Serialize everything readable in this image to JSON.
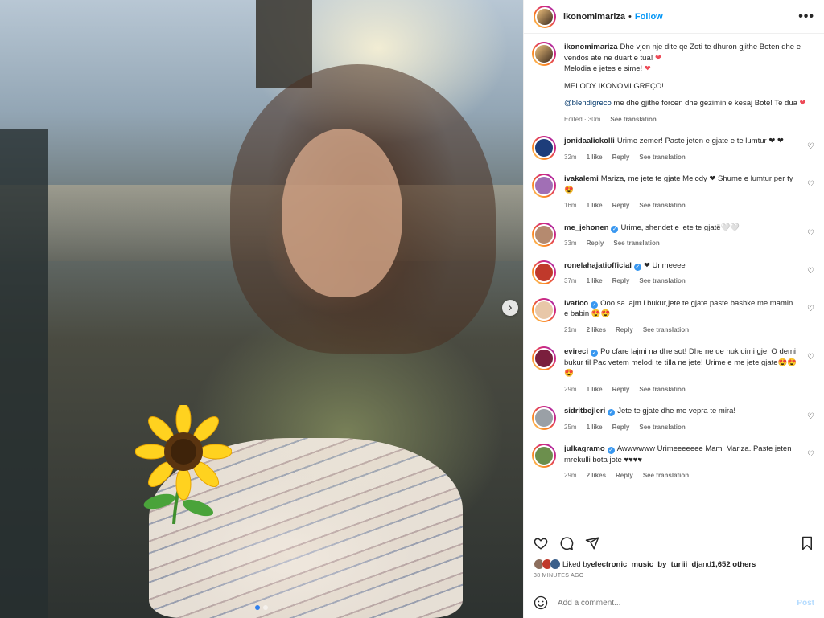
{
  "post": {
    "username": "ikonomimariza",
    "separator": "•",
    "follow_label": "Follow",
    "more_label": "•••",
    "next_label": "›",
    "slide_count": 2,
    "active_slide": 1
  },
  "caption": {
    "username": "ikonomimariza",
    "lines": [
      "Dhe vjen nje dite qe Zoti te dhuron gjithe Boten dhe e vendos ate ne duart e tua! ",
      "Melodia e jetes e sime! ",
      "MELODY IKONOMI GREÇO!"
    ],
    "mention": "@blendigreco",
    "mention_text": " me dhe gjithe forcen dhe gezimin e kesaj Bote! Te dua ",
    "heart": "❤",
    "edited": "Edited · 30m",
    "see_translation": "See translation"
  },
  "comments": [
    {
      "user": "jonidaalickolli",
      "verified": false,
      "text": "Urime zemer! Paste jeten e gjate e te lumtur ❤ ❤",
      "time": "32m",
      "likes": "1 like",
      "reply": "Reply",
      "translate": "See translation"
    },
    {
      "user": "ivakalemi",
      "verified": false,
      "text": "Mariza, me jete te gjate Melody ❤ Shume e lumtur per ty 😍",
      "time": "16m",
      "likes": "1 like",
      "reply": "Reply",
      "translate": "See translation"
    },
    {
      "user": "me_jehonen",
      "verified": true,
      "text": "Urime, shendet e jete te gjatë🤍🤍",
      "time": "33m",
      "likes": "",
      "reply": "Reply",
      "translate": "See translation"
    },
    {
      "user": "ronelahajatiofficial",
      "verified": true,
      "text": "❤ Urimeeee",
      "time": "37m",
      "likes": "1 like",
      "reply": "Reply",
      "translate": "See translation"
    },
    {
      "user": "ivatico",
      "verified": true,
      "text": "Ooo sa lajm i bukur,jete te gjate paste bashke me mamin e babin 😍😍",
      "time": "21m",
      "likes": "2 likes",
      "reply": "Reply",
      "translate": "See translation"
    },
    {
      "user": "evireci",
      "verified": true,
      "text": "Po cfare lajmi na dhe sot! Dhe ne qe nuk dimi gje! O demi bukur til Pac vetem melodi te tilla ne jete! Urime e me jete gjate😍😍😍",
      "time": "29m",
      "likes": "1 like",
      "reply": "Reply",
      "translate": "See translation"
    },
    {
      "user": "sidritbejleri",
      "verified": true,
      "text": "Jete te gjate dhe me vepra te mira!",
      "time": "25m",
      "likes": "1 like",
      "reply": "Reply",
      "translate": "See translation"
    },
    {
      "user": "julkagramo",
      "verified": true,
      "text": "Awwwwww Urimeeeeeee Mami Mariza. Paste jeten mrekulli bota jote ♥♥♥♥",
      "time": "29m",
      "likes": "2 likes",
      "reply": "Reply",
      "translate": "See translation"
    }
  ],
  "like_icon": "♡",
  "actions": {
    "liked_prefix": "Liked by ",
    "liked_user": "electronic_music_by_turiii_dj",
    "liked_and": " and ",
    "liked_others": "1,652 others",
    "time_ago": "38 MINUTES AGO",
    "comment_placeholder": "Add a comment...",
    "post_label": "Post"
  },
  "colors": {
    "accent": "#0095f6",
    "heart": "#ed4956",
    "verified": "#3897f0"
  }
}
